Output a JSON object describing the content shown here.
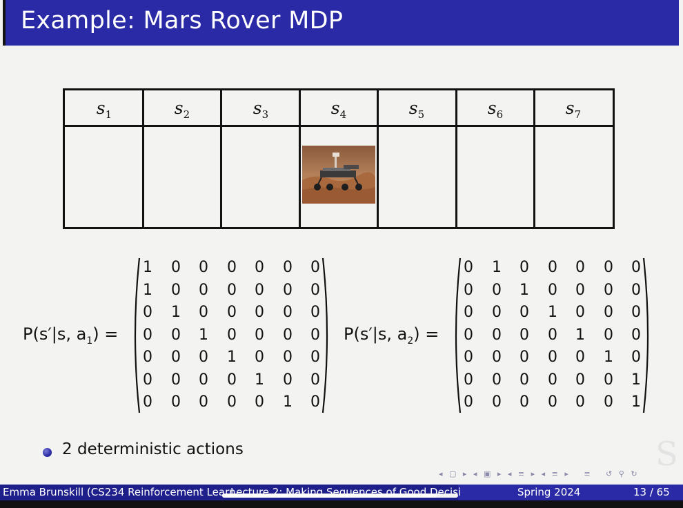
{
  "slide": {
    "title": "Example: Mars Rover MDP",
    "states": [
      {
        "base": "s",
        "sub": "1"
      },
      {
        "base": "s",
        "sub": "2"
      },
      {
        "base": "s",
        "sub": "3"
      },
      {
        "base": "s",
        "sub": "4"
      },
      {
        "base": "s",
        "sub": "5"
      },
      {
        "base": "s",
        "sub": "6"
      },
      {
        "base": "s",
        "sub": "7"
      }
    ],
    "rover_state_index": 3,
    "equations": [
      {
        "lhs_pre": "P(s′|s, a",
        "lhs_sub": "1",
        "lhs_post": ") =",
        "matrix": [
          [
            1,
            0,
            0,
            0,
            0,
            0,
            0
          ],
          [
            1,
            0,
            0,
            0,
            0,
            0,
            0
          ],
          [
            0,
            1,
            0,
            0,
            0,
            0,
            0
          ],
          [
            0,
            0,
            1,
            0,
            0,
            0,
            0
          ],
          [
            0,
            0,
            0,
            1,
            0,
            0,
            0
          ],
          [
            0,
            0,
            0,
            0,
            1,
            0,
            0
          ],
          [
            0,
            0,
            0,
            0,
            0,
            1,
            0
          ]
        ]
      },
      {
        "lhs_pre": "P(s′|s, a",
        "lhs_sub": "2",
        "lhs_post": ") =",
        "matrix": [
          [
            0,
            1,
            0,
            0,
            0,
            0,
            0
          ],
          [
            0,
            0,
            1,
            0,
            0,
            0,
            0
          ],
          [
            0,
            0,
            0,
            1,
            0,
            0,
            0
          ],
          [
            0,
            0,
            0,
            0,
            1,
            0,
            0
          ],
          [
            0,
            0,
            0,
            0,
            0,
            1,
            0
          ],
          [
            0,
            0,
            0,
            0,
            0,
            0,
            1
          ],
          [
            0,
            0,
            0,
            0,
            0,
            0,
            1
          ]
        ]
      }
    ],
    "bullets": [
      "2 deterministic actions"
    ]
  },
  "footer": {
    "author": "Emma Brunskill (CS234 Reinforcement Learn",
    "lecture": "Lecture 2: Making Sequences of Good Decisi",
    "term": "Spring 2024",
    "page": "13 / 65"
  },
  "video": {
    "progress_fraction": 0.91
  },
  "colors": {
    "title_bar": "#2a2aa6",
    "slide_bg": "#f3f3f1",
    "footer_dark": "#1f1f8c"
  }
}
